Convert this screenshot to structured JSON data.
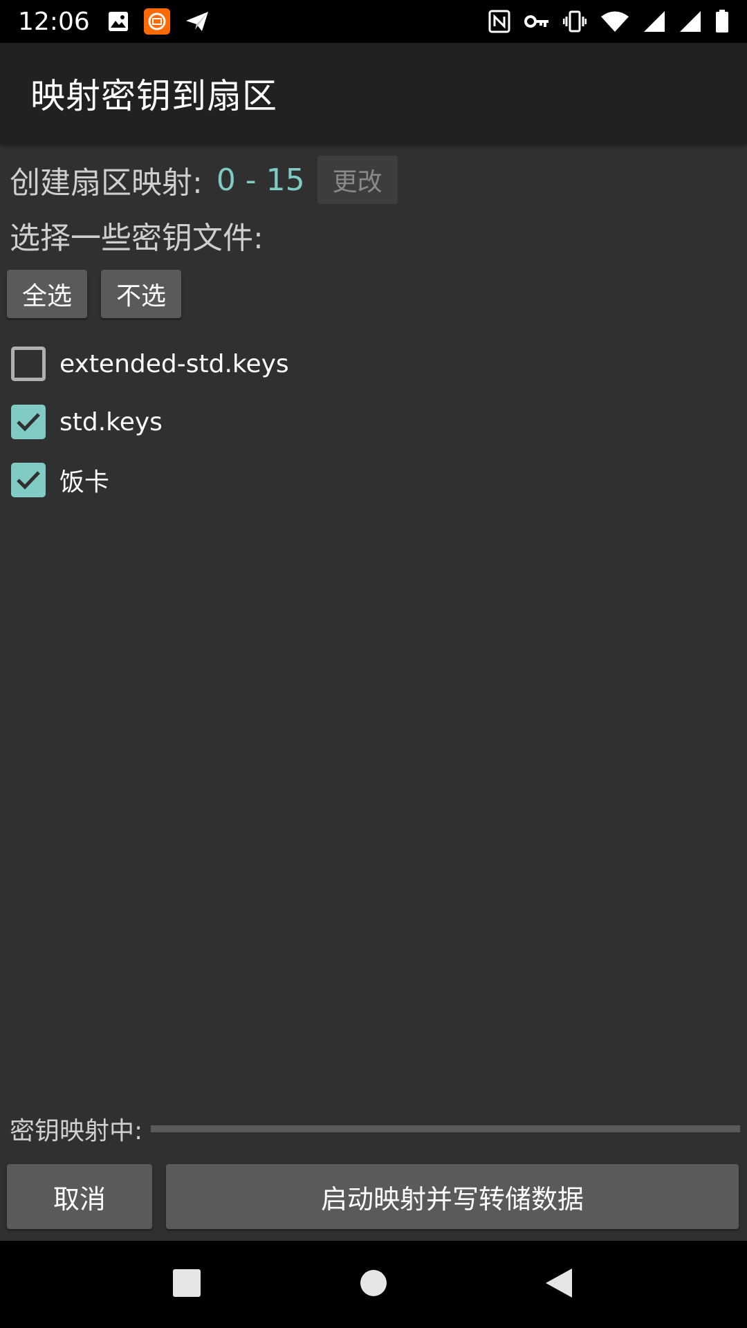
{
  "status_bar": {
    "time": "12:06",
    "left_icons": [
      "image-icon",
      "mi-app-icon",
      "send-icon"
    ],
    "right_icons": [
      "nfc-icon",
      "key-icon",
      "vibrate-icon",
      "wifi-icon",
      "signal-icon",
      "signal-icon-2",
      "battery-icon"
    ]
  },
  "app_bar": {
    "title": "映射密钥到扇区"
  },
  "sector": {
    "label": "创建扇区映射:",
    "value": "0 - 15",
    "change_label": "更改"
  },
  "choose_label": "选择一些密钥文件:",
  "select_buttons": {
    "all": "全选",
    "none": "不选"
  },
  "key_files": [
    {
      "name": "extended-std.keys",
      "checked": false
    },
    {
      "name": "std.keys",
      "checked": true
    },
    {
      "name": "饭卡",
      "checked": true
    }
  ],
  "progress": {
    "label": "密钥映射中:",
    "value_percent": 0
  },
  "bottom": {
    "cancel": "取消",
    "start": "启动映射并写转储数据"
  },
  "colors": {
    "accent": "#80cbc4",
    "background": "#303030",
    "app_bar": "#212121",
    "button": "#5a5a5a"
  },
  "nav_bar": {
    "icons": [
      "recents-icon",
      "home-icon",
      "back-icon"
    ]
  }
}
